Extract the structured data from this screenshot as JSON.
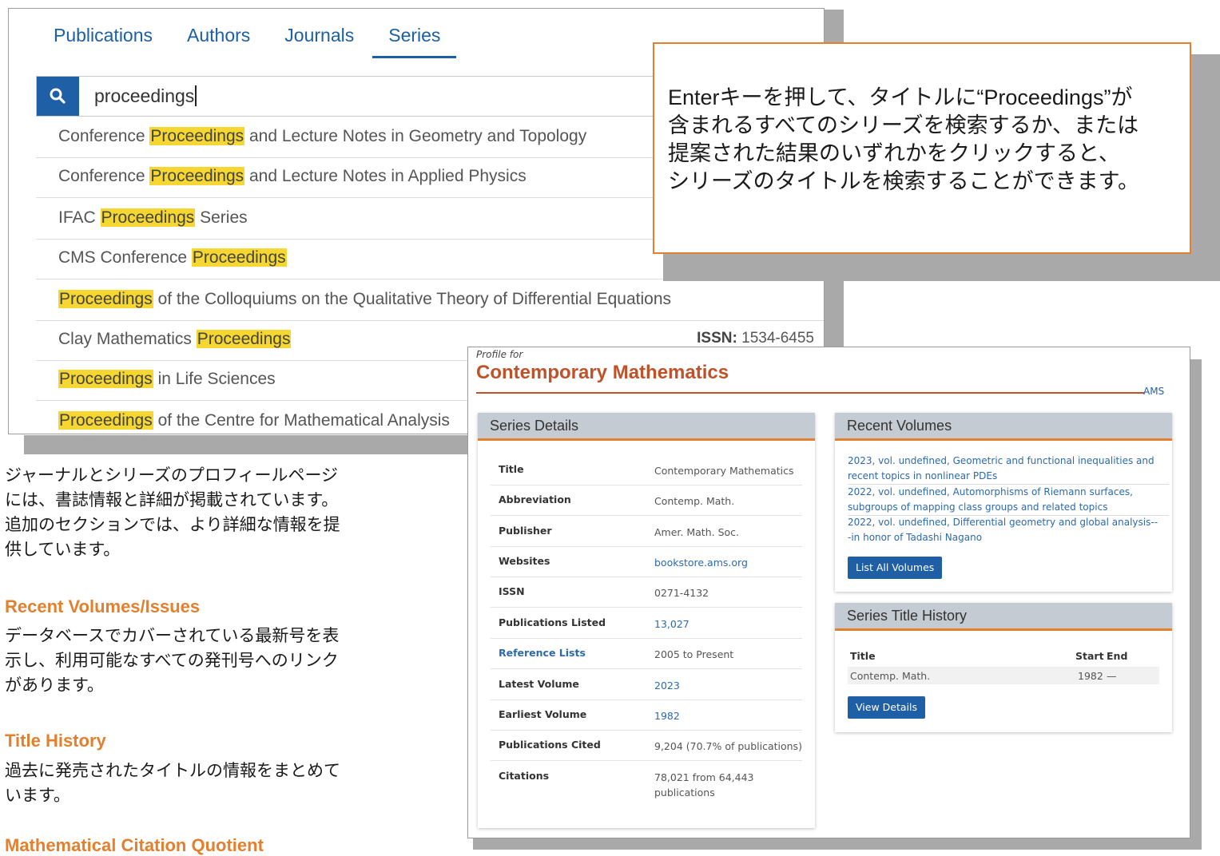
{
  "search_panel": {
    "tabs": [
      "Publications",
      "Authors",
      "Journals",
      "Series"
    ],
    "active_tab": "Series",
    "search_value": "proceedings",
    "results": [
      {
        "pre": "Conference ",
        "hl": "Proceedings",
        "post": " and Lecture Notes in Geometry and Topology",
        "issn_label": "",
        "issn": ""
      },
      {
        "pre": "Conference ",
        "hl": "Proceedings",
        "post": " and Lecture Notes in Applied Physics",
        "issn_label": "",
        "issn": ""
      },
      {
        "pre": "IFAC ",
        "hl": "Proceedings",
        "post": " Series",
        "issn_label": "",
        "issn": ""
      },
      {
        "pre": "CMS Conference ",
        "hl": "Proceedings",
        "post": "",
        "issn_label": "",
        "issn": ""
      },
      {
        "pre": "",
        "hl": "Proceedings",
        "post": " of the Colloquiums on the Qualitative Theory of Differential Equations",
        "issn_label": "",
        "issn": ""
      },
      {
        "pre": "Clay Mathematics ",
        "hl": "Proceedings",
        "post": "",
        "issn_label": "ISSN:",
        "issn": "1534-6455"
      },
      {
        "pre": "",
        "hl": "Proceedings",
        "post": " in Life Sciences",
        "issn_label": "",
        "issn": ""
      },
      {
        "pre": "",
        "hl": "Proceedings",
        "post": " of the Centre for Mathematical Analysis",
        "issn_label": "",
        "issn": ""
      }
    ]
  },
  "callout": {
    "lines": [
      "Enterキーを押して、タイトルに“Proceedings”が",
      "含まれるすべてのシリーズを検索するか、または",
      "提案された結果のいずれかをクリックすると、",
      "シリーズのタイトルを検索することができます。"
    ]
  },
  "left_column": {
    "intro_lines": [
      "ジャーナルとシリーズのプロフィールページ",
      "には、書誌情報と詳細が掲載されています。",
      "追加のセクションでは、より詳細な情報を提",
      "供しています。"
    ],
    "recent_heading": "Recent Volumes/Issues",
    "recent_lines": [
      "データベースでカバーされている最新号を表",
      "示し、利用可能なすべての発刊号へのリンク",
      "があります。"
    ],
    "title_heading": "Title History",
    "title_lines": [
      "過去に発売されたタイトルの情報をまとめて",
      "います。"
    ],
    "mcq_heading": "Mathematical Citation Quotient"
  },
  "profile": {
    "profile_for": "Profile for",
    "title": "Contemporary Mathematics",
    "logo_text": "AMS",
    "series_details": {
      "heading": "Series Details",
      "rows": [
        {
          "key": "Title",
          "value": "Contemporary Mathematics"
        },
        {
          "key": "Abbreviation",
          "value": "Contemp. Math."
        },
        {
          "key": "Publisher",
          "value": "Amer. Math. Soc."
        },
        {
          "key": "Websites",
          "value": "bookstore.ams.org"
        },
        {
          "key": "ISSN",
          "value": "0271-4132"
        },
        {
          "key": "Publications Listed",
          "value": "13,027"
        },
        {
          "key": "Reference Lists",
          "value": "2005 to Present"
        },
        {
          "key": "Latest Volume",
          "value": "2023"
        },
        {
          "key": "Earliest Volume",
          "value": "1982"
        },
        {
          "key": "Publications Cited",
          "value": "9,204 (70.7% of publications)"
        },
        {
          "key": "Citations",
          "value": "78,021 from 64,443 publications"
        }
      ]
    },
    "recent_volumes": {
      "heading": "Recent Volumes",
      "items": [
        "2023, vol. undefined, Geometric and functional inequalities and recent topics in nonlinear PDEs",
        "2022, vol. undefined, Automorphisms of Riemann surfaces, subgroups of mapping class groups and related topics",
        "2022, vol. undefined, Differential geometry and global analysis---in honor of Tadashi Nagano"
      ],
      "button": "List All Volumes"
    },
    "title_history": {
      "heading": "Series Title History",
      "col_title": "Title",
      "col_start": "Start",
      "col_end": "End",
      "row": {
        "title": "Contemp. Math.",
        "start": "1982",
        "end": "—"
      },
      "button": "View Details"
    }
  }
}
